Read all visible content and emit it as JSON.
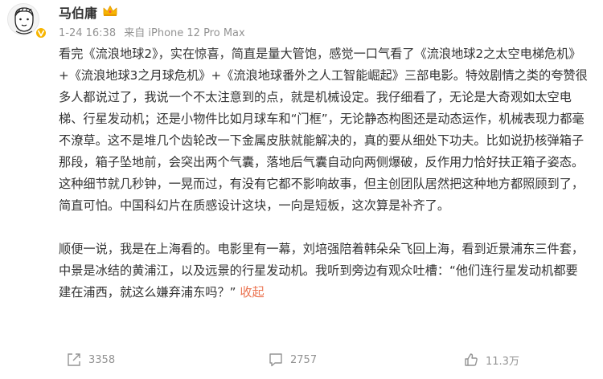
{
  "author": {
    "name": "马伯庸",
    "avatar_icon": "cartoon-portrait",
    "verified_icon": "verified-v-badge",
    "badge_icon": "crown-icon"
  },
  "meta": {
    "time": "1-24 16:38",
    "source": "来自 iPhone 12 Pro Max"
  },
  "content": {
    "paragraph1": "看完《流浪地球2》，实在惊喜，简直是量大管饱，感觉一口气看了《流浪地球2之太空电梯危机》+《流浪地球3之月球危机》+《流浪地球番外之人工智能崛起》三部电影。特效剧情之类的夸赞很多人都说过了，我说一个不太注意到的点，就是机械设定。我仔细看了，无论是大奇观如太空电梯、行星发动机；还是小物件比如月球车和“门框”，无论静态构图还是动态运作，机械表现力都毫不潦草。这不是堆几个齿轮改一下金属皮肤就能解决的，真的要从细处下功夫。比如说扔核弹箱子那段，箱子坠地前，会突出两个气囊，落地后气囊自动向两侧爆破，反作用力恰好扶正箱子姿态。这种细节就几秒钟，一晃而过，有没有它都不影响故事，但主创团队居然把这种地方都照顾到了，简直可怕。中国科幻片在质感设计这块，一向是短板，这次算是补齐了。",
    "paragraph2": "顺便一说，我是在上海看的。电影里有一幕，刘培强陪着韩朵朵飞回上海，看到近景浦东三件套，中景是冰结的黄浦江，以及远景的行星发动机。我听到旁边有观众吐槽：“他们连行星发动机都要建在浦西，就这么嫌弃浦东吗？”",
    "collapse": "收起"
  },
  "actions": {
    "share_count": "3358",
    "comment_count": "2757",
    "like_count": "11.3万"
  },
  "colors": {
    "link": "#eb7350",
    "meta": "#939393",
    "text": "#333333"
  }
}
